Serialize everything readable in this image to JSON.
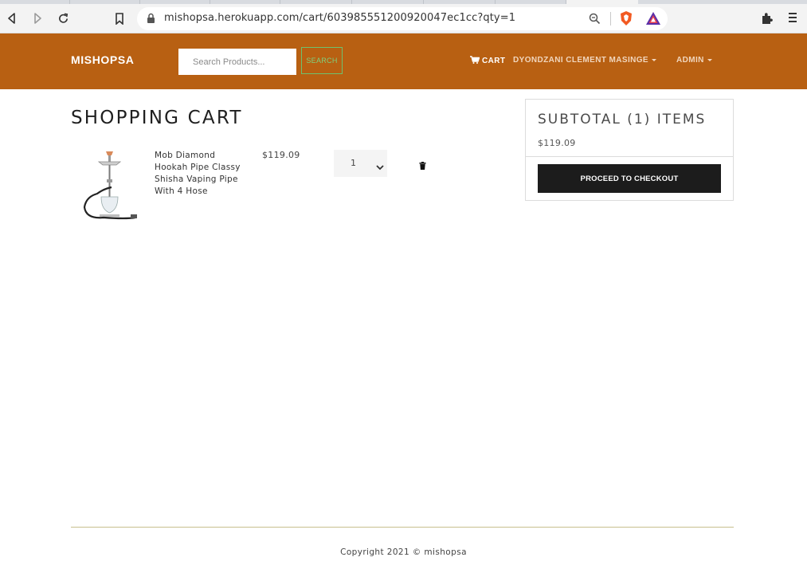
{
  "browser": {
    "url": "mishopsa.herokuapp.com/cart/603985551200920047ec1cc?qty=1"
  },
  "navbar": {
    "brand": "MISHOPSA",
    "search_placeholder": "Search Products...",
    "search_button": "SEARCH",
    "cart_label": "CART",
    "user_label": "DYONDZANI CLEMENT MASINGE",
    "admin_label": "ADMIN",
    "brand_color": "#b86012"
  },
  "cart": {
    "title": "SHOPPING CART",
    "items": [
      {
        "name": "Mob Diamond Hookah Pipe Classy Shisha Vaping Pipe With 4 Hose",
        "price": "$119.09",
        "qty": "1"
      }
    ]
  },
  "summary": {
    "title": "SUBTOTAL (1) ITEMS",
    "total": "$119.09",
    "checkout_label": "PROCEED TO CHECKOUT"
  },
  "footer": {
    "copyright": "Copyright 2021 © mishopsa"
  }
}
